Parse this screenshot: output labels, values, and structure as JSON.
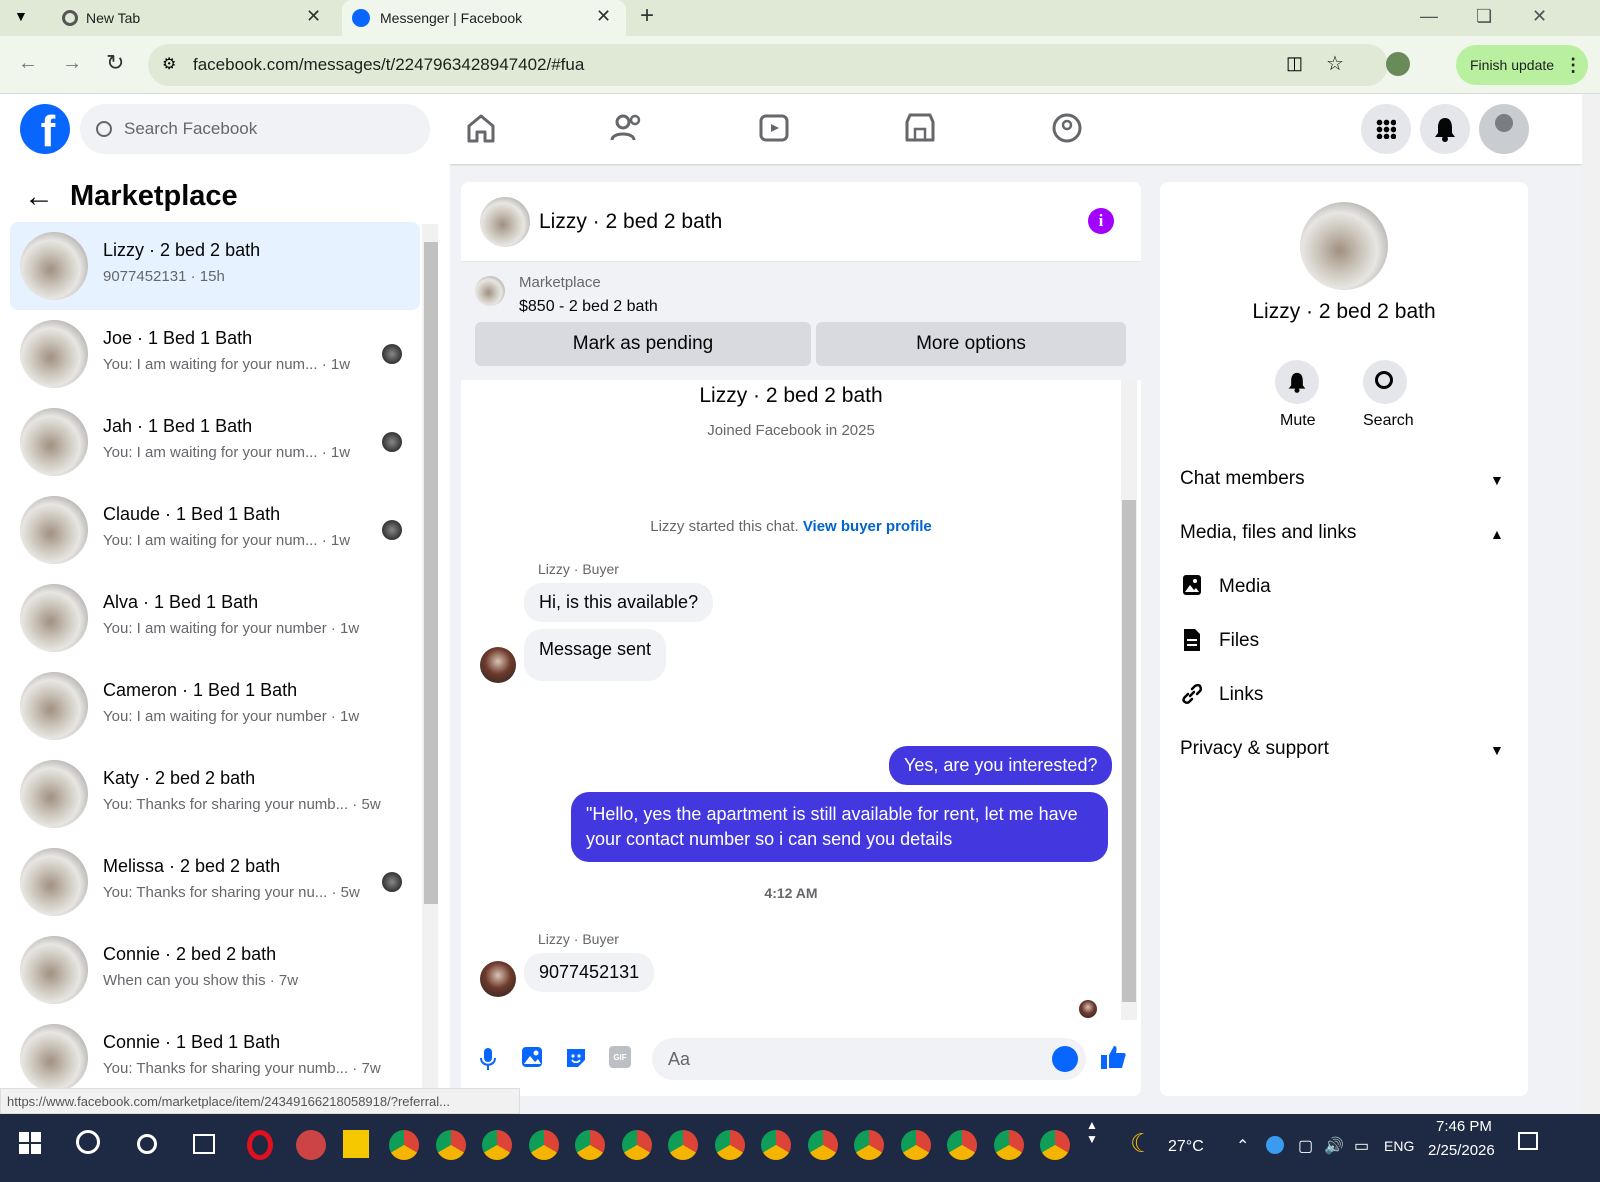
{
  "browser": {
    "tabs": [
      {
        "label": "New Tab"
      },
      {
        "label": "Messenger | Facebook"
      }
    ],
    "url": "facebook.com/messages/t/2247963428947402/#fua",
    "finish_update": "Finish update",
    "status_url": "https://www.facebook.com/marketplace/item/243491662180589​18/?referral..."
  },
  "header": {
    "search_placeholder": "Search Facebook",
    "logo": "f"
  },
  "left": {
    "title": "Marketplace",
    "conversations": [
      {
        "title": "Lizzy · 2 bed 2 bath",
        "sub": "9077452131 · 15h",
        "selected": true
      },
      {
        "title": "Joe · 1 Bed 1 Bath",
        "sub": "You: I am waiting for your num... · 1w"
      },
      {
        "title": "Jah · 1 Bed 1 Bath",
        "sub": "You: I am waiting for your num... · 1w"
      },
      {
        "title": "Claude · 1 Bed 1 Bath",
        "sub": "You: I am waiting for your num... · 1w"
      },
      {
        "title": "Alva · 1 Bed 1 Bath",
        "sub": "You: I am waiting for your number · 1w"
      },
      {
        "title": "Cameron · 1 Bed 1 Bath",
        "sub": "You: I am waiting for your number · 1w"
      },
      {
        "title": "Katy · 2 bed 2 bath",
        "sub": "You: Thanks for sharing your numb... · 5w"
      },
      {
        "title": "Melissa · 2 bed 2 bath",
        "sub": "You: Thanks for sharing your nu... · 5w"
      },
      {
        "title": "Connie · 2 bed 2 bath",
        "sub": "When can you show this · 7w"
      },
      {
        "title": "Connie · 1 Bed 1 Bath",
        "sub": "You: Thanks for sharing your numb... · 7w"
      }
    ]
  },
  "chat": {
    "name": "Lizzy · 2 bed 2 bath",
    "listing_source": "Marketplace",
    "listing_price": "$850 - 2 bed 2 bath",
    "mark_pending": "Mark as pending",
    "more_options": "More options",
    "profile_name": "Lizzy · 2 bed 2 bath",
    "joined": "Joined Facebook in 2025",
    "started_prefix": "Lizzy started this chat.",
    "view_buyer": "View buyer profile",
    "sender_label": "Lizzy · Buyer",
    "msg1": "Hi, is this available?",
    "msg2": "Message sent",
    "out1": "Yes, are you interested?",
    "out2_line1": "\"Hello, yes the apartment is still available for rent, let me have",
    "out2_line2": "your contact number so i can send you details",
    "time": "4:12 AM",
    "sender_label2": "Lizzy · Buyer",
    "msg3": "9077452131",
    "input_placeholder": "Aa"
  },
  "right": {
    "name": "Lizzy · 2 bed 2 bath",
    "mute": "Mute",
    "search": "Search",
    "chat_members": "Chat members",
    "media_files_links": "Media, files and links",
    "media": "Media",
    "files": "Files",
    "links": "Links",
    "privacy": "Privacy & support"
  },
  "taskbar": {
    "temp": "27°C",
    "lang": "ENG",
    "time": "7:46 PM",
    "date": "2/25/2026"
  },
  "colors": {
    "fb_blue": "#0866ff",
    "outgoing_bubble": "#4338e0",
    "info_icon": "#a200ff",
    "finish_update": "#b9f0a0"
  }
}
